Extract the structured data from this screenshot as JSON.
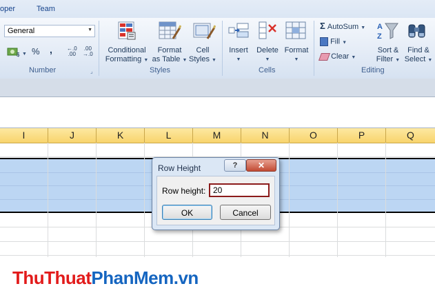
{
  "tabs": [
    {
      "label": "oper"
    },
    {
      "label": "Team"
    }
  ],
  "ribbon": {
    "number": {
      "format_value": "General",
      "currency_symbol": "$",
      "percent_symbol": "%",
      "comma_symbol": ",",
      "increase_decimal": "←.0\n.00",
      "decrease_decimal": ".00\n→.0",
      "group_label": "Number"
    },
    "styles": {
      "conditional_formatting": {
        "line1": "Conditional",
        "line2": "Formatting"
      },
      "format_as_table": {
        "line1": "Format",
        "line2": "as Table"
      },
      "cell_styles": {
        "line1": "Cell",
        "line2": "Styles"
      },
      "group_label": "Styles"
    },
    "cells": {
      "insert": "Insert",
      "delete": "Delete",
      "format": "Format",
      "group_label": "Cells"
    },
    "editing": {
      "autosum": "AutoSum",
      "fill": "Fill",
      "clear": "Clear",
      "sort_filter": {
        "line1": "Sort &",
        "line2": "Filter"
      },
      "find_select": {
        "line1": "Find &",
        "line2": "Select"
      },
      "group_label": "Editing"
    }
  },
  "columns": [
    "I",
    "J",
    "K",
    "L",
    "M",
    "N",
    "O",
    "P",
    "Q"
  ],
  "dialog": {
    "title": "Row Height",
    "help": "?",
    "close": "✕",
    "field_label": "Row height:",
    "field_value": "20",
    "ok": "OK",
    "cancel": "Cancel"
  },
  "watermark": {
    "part1": "Thu",
    "part2": "Thuat",
    "part3": "Phan",
    "part4": "Mem",
    "part5": ".vn"
  }
}
